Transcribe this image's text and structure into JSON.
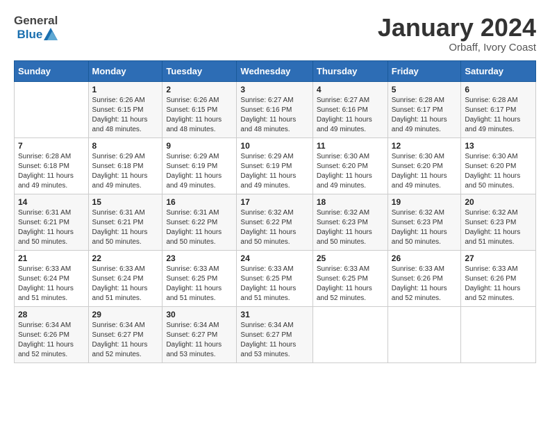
{
  "header": {
    "logo_general": "General",
    "logo_blue": "Blue",
    "title": "January 2024",
    "subtitle": "Orbaff, Ivory Coast"
  },
  "days_of_week": [
    "Sunday",
    "Monday",
    "Tuesday",
    "Wednesday",
    "Thursday",
    "Friday",
    "Saturday"
  ],
  "weeks": [
    [
      {
        "day": "",
        "sunrise": "",
        "sunset": "",
        "daylight": ""
      },
      {
        "day": "1",
        "sunrise": "Sunrise: 6:26 AM",
        "sunset": "Sunset: 6:15 PM",
        "daylight": "Daylight: 11 hours and 48 minutes."
      },
      {
        "day": "2",
        "sunrise": "Sunrise: 6:26 AM",
        "sunset": "Sunset: 6:15 PM",
        "daylight": "Daylight: 11 hours and 48 minutes."
      },
      {
        "day": "3",
        "sunrise": "Sunrise: 6:27 AM",
        "sunset": "Sunset: 6:16 PM",
        "daylight": "Daylight: 11 hours and 48 minutes."
      },
      {
        "day": "4",
        "sunrise": "Sunrise: 6:27 AM",
        "sunset": "Sunset: 6:16 PM",
        "daylight": "Daylight: 11 hours and 49 minutes."
      },
      {
        "day": "5",
        "sunrise": "Sunrise: 6:28 AM",
        "sunset": "Sunset: 6:17 PM",
        "daylight": "Daylight: 11 hours and 49 minutes."
      },
      {
        "day": "6",
        "sunrise": "Sunrise: 6:28 AM",
        "sunset": "Sunset: 6:17 PM",
        "daylight": "Daylight: 11 hours and 49 minutes."
      }
    ],
    [
      {
        "day": "7",
        "sunrise": "Sunrise: 6:28 AM",
        "sunset": "Sunset: 6:18 PM",
        "daylight": "Daylight: 11 hours and 49 minutes."
      },
      {
        "day": "8",
        "sunrise": "Sunrise: 6:29 AM",
        "sunset": "Sunset: 6:18 PM",
        "daylight": "Daylight: 11 hours and 49 minutes."
      },
      {
        "day": "9",
        "sunrise": "Sunrise: 6:29 AM",
        "sunset": "Sunset: 6:19 PM",
        "daylight": "Daylight: 11 hours and 49 minutes."
      },
      {
        "day": "10",
        "sunrise": "Sunrise: 6:29 AM",
        "sunset": "Sunset: 6:19 PM",
        "daylight": "Daylight: 11 hours and 49 minutes."
      },
      {
        "day": "11",
        "sunrise": "Sunrise: 6:30 AM",
        "sunset": "Sunset: 6:20 PM",
        "daylight": "Daylight: 11 hours and 49 minutes."
      },
      {
        "day": "12",
        "sunrise": "Sunrise: 6:30 AM",
        "sunset": "Sunset: 6:20 PM",
        "daylight": "Daylight: 11 hours and 49 minutes."
      },
      {
        "day": "13",
        "sunrise": "Sunrise: 6:30 AM",
        "sunset": "Sunset: 6:20 PM",
        "daylight": "Daylight: 11 hours and 50 minutes."
      }
    ],
    [
      {
        "day": "14",
        "sunrise": "Sunrise: 6:31 AM",
        "sunset": "Sunset: 6:21 PM",
        "daylight": "Daylight: 11 hours and 50 minutes."
      },
      {
        "day": "15",
        "sunrise": "Sunrise: 6:31 AM",
        "sunset": "Sunset: 6:21 PM",
        "daylight": "Daylight: 11 hours and 50 minutes."
      },
      {
        "day": "16",
        "sunrise": "Sunrise: 6:31 AM",
        "sunset": "Sunset: 6:22 PM",
        "daylight": "Daylight: 11 hours and 50 minutes."
      },
      {
        "day": "17",
        "sunrise": "Sunrise: 6:32 AM",
        "sunset": "Sunset: 6:22 PM",
        "daylight": "Daylight: 11 hours and 50 minutes."
      },
      {
        "day": "18",
        "sunrise": "Sunrise: 6:32 AM",
        "sunset": "Sunset: 6:23 PM",
        "daylight": "Daylight: 11 hours and 50 minutes."
      },
      {
        "day": "19",
        "sunrise": "Sunrise: 6:32 AM",
        "sunset": "Sunset: 6:23 PM",
        "daylight": "Daylight: 11 hours and 50 minutes."
      },
      {
        "day": "20",
        "sunrise": "Sunrise: 6:32 AM",
        "sunset": "Sunset: 6:23 PM",
        "daylight": "Daylight: 11 hours and 51 minutes."
      }
    ],
    [
      {
        "day": "21",
        "sunrise": "Sunrise: 6:33 AM",
        "sunset": "Sunset: 6:24 PM",
        "daylight": "Daylight: 11 hours and 51 minutes."
      },
      {
        "day": "22",
        "sunrise": "Sunrise: 6:33 AM",
        "sunset": "Sunset: 6:24 PM",
        "daylight": "Daylight: 11 hours and 51 minutes."
      },
      {
        "day": "23",
        "sunrise": "Sunrise: 6:33 AM",
        "sunset": "Sunset: 6:25 PM",
        "daylight": "Daylight: 11 hours and 51 minutes."
      },
      {
        "day": "24",
        "sunrise": "Sunrise: 6:33 AM",
        "sunset": "Sunset: 6:25 PM",
        "daylight": "Daylight: 11 hours and 51 minutes."
      },
      {
        "day": "25",
        "sunrise": "Sunrise: 6:33 AM",
        "sunset": "Sunset: 6:25 PM",
        "daylight": "Daylight: 11 hours and 52 minutes."
      },
      {
        "day": "26",
        "sunrise": "Sunrise: 6:33 AM",
        "sunset": "Sunset: 6:26 PM",
        "daylight": "Daylight: 11 hours and 52 minutes."
      },
      {
        "day": "27",
        "sunrise": "Sunrise: 6:33 AM",
        "sunset": "Sunset: 6:26 PM",
        "daylight": "Daylight: 11 hours and 52 minutes."
      }
    ],
    [
      {
        "day": "28",
        "sunrise": "Sunrise: 6:34 AM",
        "sunset": "Sunset: 6:26 PM",
        "daylight": "Daylight: 11 hours and 52 minutes."
      },
      {
        "day": "29",
        "sunrise": "Sunrise: 6:34 AM",
        "sunset": "Sunset: 6:27 PM",
        "daylight": "Daylight: 11 hours and 52 minutes."
      },
      {
        "day": "30",
        "sunrise": "Sunrise: 6:34 AM",
        "sunset": "Sunset: 6:27 PM",
        "daylight": "Daylight: 11 hours and 53 minutes."
      },
      {
        "day": "31",
        "sunrise": "Sunrise: 6:34 AM",
        "sunset": "Sunset: 6:27 PM",
        "daylight": "Daylight: 11 hours and 53 minutes."
      },
      {
        "day": "",
        "sunrise": "",
        "sunset": "",
        "daylight": ""
      },
      {
        "day": "",
        "sunrise": "",
        "sunset": "",
        "daylight": ""
      },
      {
        "day": "",
        "sunrise": "",
        "sunset": "",
        "daylight": ""
      }
    ]
  ]
}
